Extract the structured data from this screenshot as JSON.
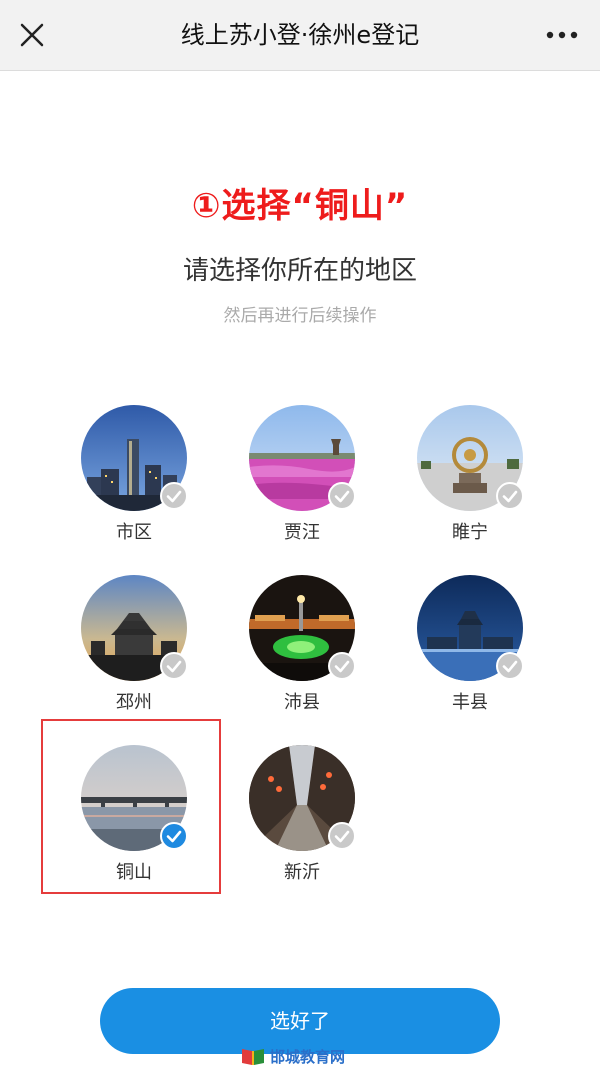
{
  "header": {
    "title": "线上苏小登·徐州e登记"
  },
  "annotation": {
    "step_text": "①选择“铜山”"
  },
  "main": {
    "heading": "请选择你所在的地区",
    "subheading": "然后再进行后续操作"
  },
  "regions": [
    {
      "label": "市区",
      "selected": false
    },
    {
      "label": "贾汪",
      "selected": false
    },
    {
      "label": "睢宁",
      "selected": false
    },
    {
      "label": "邳州",
      "selected": false
    },
    {
      "label": "沛县",
      "selected": false
    },
    {
      "label": "丰县",
      "selected": false
    },
    {
      "label": "铜山",
      "selected": true
    },
    {
      "label": "新沂",
      "selected": false
    }
  ],
  "footer": {
    "confirm_label": "选好了"
  },
  "watermark": {
    "text": "邯城教育网"
  },
  "colors": {
    "accent": "#1a8fe3",
    "annotation_red": "#ee1c1c",
    "check_gray": "#c9c9c9"
  }
}
